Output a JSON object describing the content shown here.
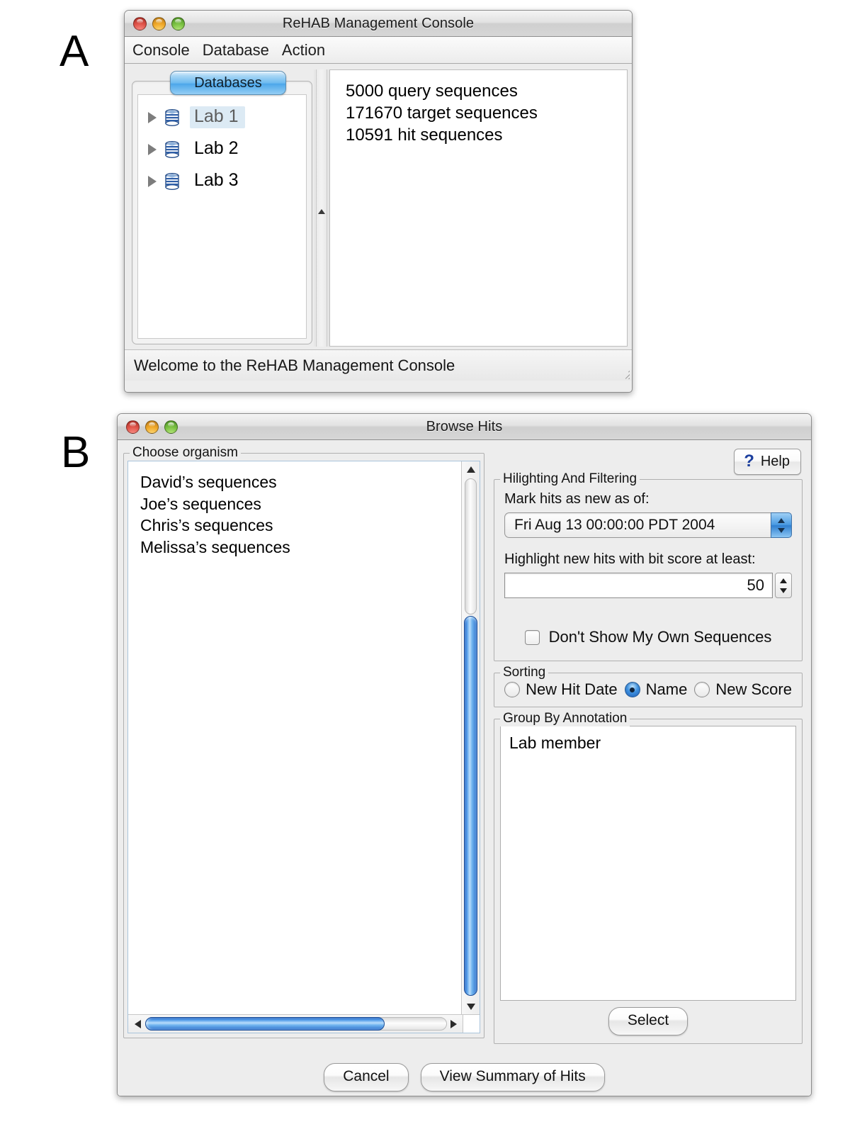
{
  "figure": {
    "label_a": "A",
    "label_b": "B"
  },
  "window_a": {
    "title": "ReHAB Management Console",
    "traffic_lights": [
      "close-button",
      "minimize-button",
      "zoom-button"
    ],
    "menus": [
      "Console",
      "Database",
      "Action"
    ],
    "tab_label": "Databases",
    "tree_items": [
      {
        "label": "Lab 1",
        "selected": true
      },
      {
        "label": "Lab 2",
        "selected": false
      },
      {
        "label": "Lab 3",
        "selected": false
      }
    ],
    "info_lines": [
      "5000 query sequences",
      "171670 target sequences",
      "10591 hit sequences"
    ],
    "status_text": "Welcome to the ReHAB Management Console"
  },
  "window_b": {
    "title": "Browse Hits",
    "organism_group_label": "Choose organism",
    "organisms": [
      "David’s sequences",
      "Joe’s sequences",
      "Chris’s sequences",
      "Melissa’s sequences"
    ],
    "help_label": "Help",
    "help_icon": "question-mark-icon",
    "highlight_group_label": "Hilighting And Filtering",
    "date_field_label": "Mark hits as new as of:",
    "date_value": "Fri Aug 13 00:00:00 PDT 2004",
    "bitscore_label": "Highlight new hits with bit score at least:",
    "bitscore_value": "50",
    "checkbox_label": "Don't Show My Own Sequences",
    "checkbox_checked": false,
    "sorting_group_label": "Sorting",
    "sorting_options": [
      {
        "label": "New Hit Date",
        "checked": false
      },
      {
        "label": "Name",
        "checked": true
      },
      {
        "label": "New Score",
        "checked": false
      }
    ],
    "group_by_label": "Group By Annotation",
    "annotations": [
      "Lab member"
    ],
    "select_label": "Select",
    "cancel_label": "Cancel",
    "view_summary_label": "View Summary of Hits"
  },
  "colors": {
    "accent_blue": "#4a9ae2",
    "selection_blue": "#dceaf4",
    "window_chrome": "#ededed",
    "help_icon_blue": "#1c3f9e"
  }
}
